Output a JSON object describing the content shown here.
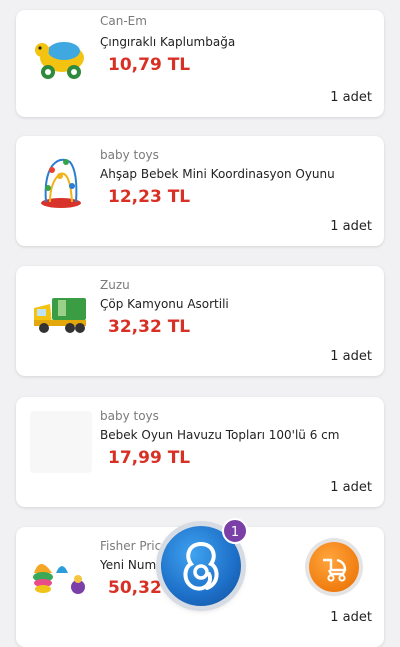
{
  "items": [
    {
      "brand": "Can-Em",
      "title": "Çıngıraklı Kaplumbağa",
      "price": "10,79 TL",
      "qty": "1 adet",
      "image_icon": "turtle-toy-icon"
    },
    {
      "brand": "baby toys",
      "title": "Ahşap Bebek Mini Koordinasyon Oyunu",
      "price": "12,23 TL",
      "qty": "1 adet",
      "image_icon": "bead-maze-icon"
    },
    {
      "brand": "Zuzu",
      "title": "Çöp Kamyonu Asortili",
      "price": "32,32 TL",
      "qty": "1 adet",
      "image_icon": "garbage-truck-icon"
    },
    {
      "brand": "baby toys",
      "title": "Bebek Oyun Havuzu Topları 100'lü 6 cm",
      "price": "17,99 TL",
      "qty": "1 adet",
      "image_icon": "ball-pit-icon"
    },
    {
      "brand": "Fisher Price",
      "title": "Yeni Numa",
      "price": "50,32",
      "qty": "1 adet",
      "image_icon": "stacking-cups-icon"
    }
  ],
  "fab": {
    "badge": "1",
    "icon": "assistant-logo-icon"
  },
  "cart_button": {
    "icon": "stroller-icon"
  },
  "colors": {
    "price": "#d93025",
    "fab_blue": "#1d6fc7",
    "badge": "#7b3fa8",
    "cart_orange": "#f07d10"
  }
}
